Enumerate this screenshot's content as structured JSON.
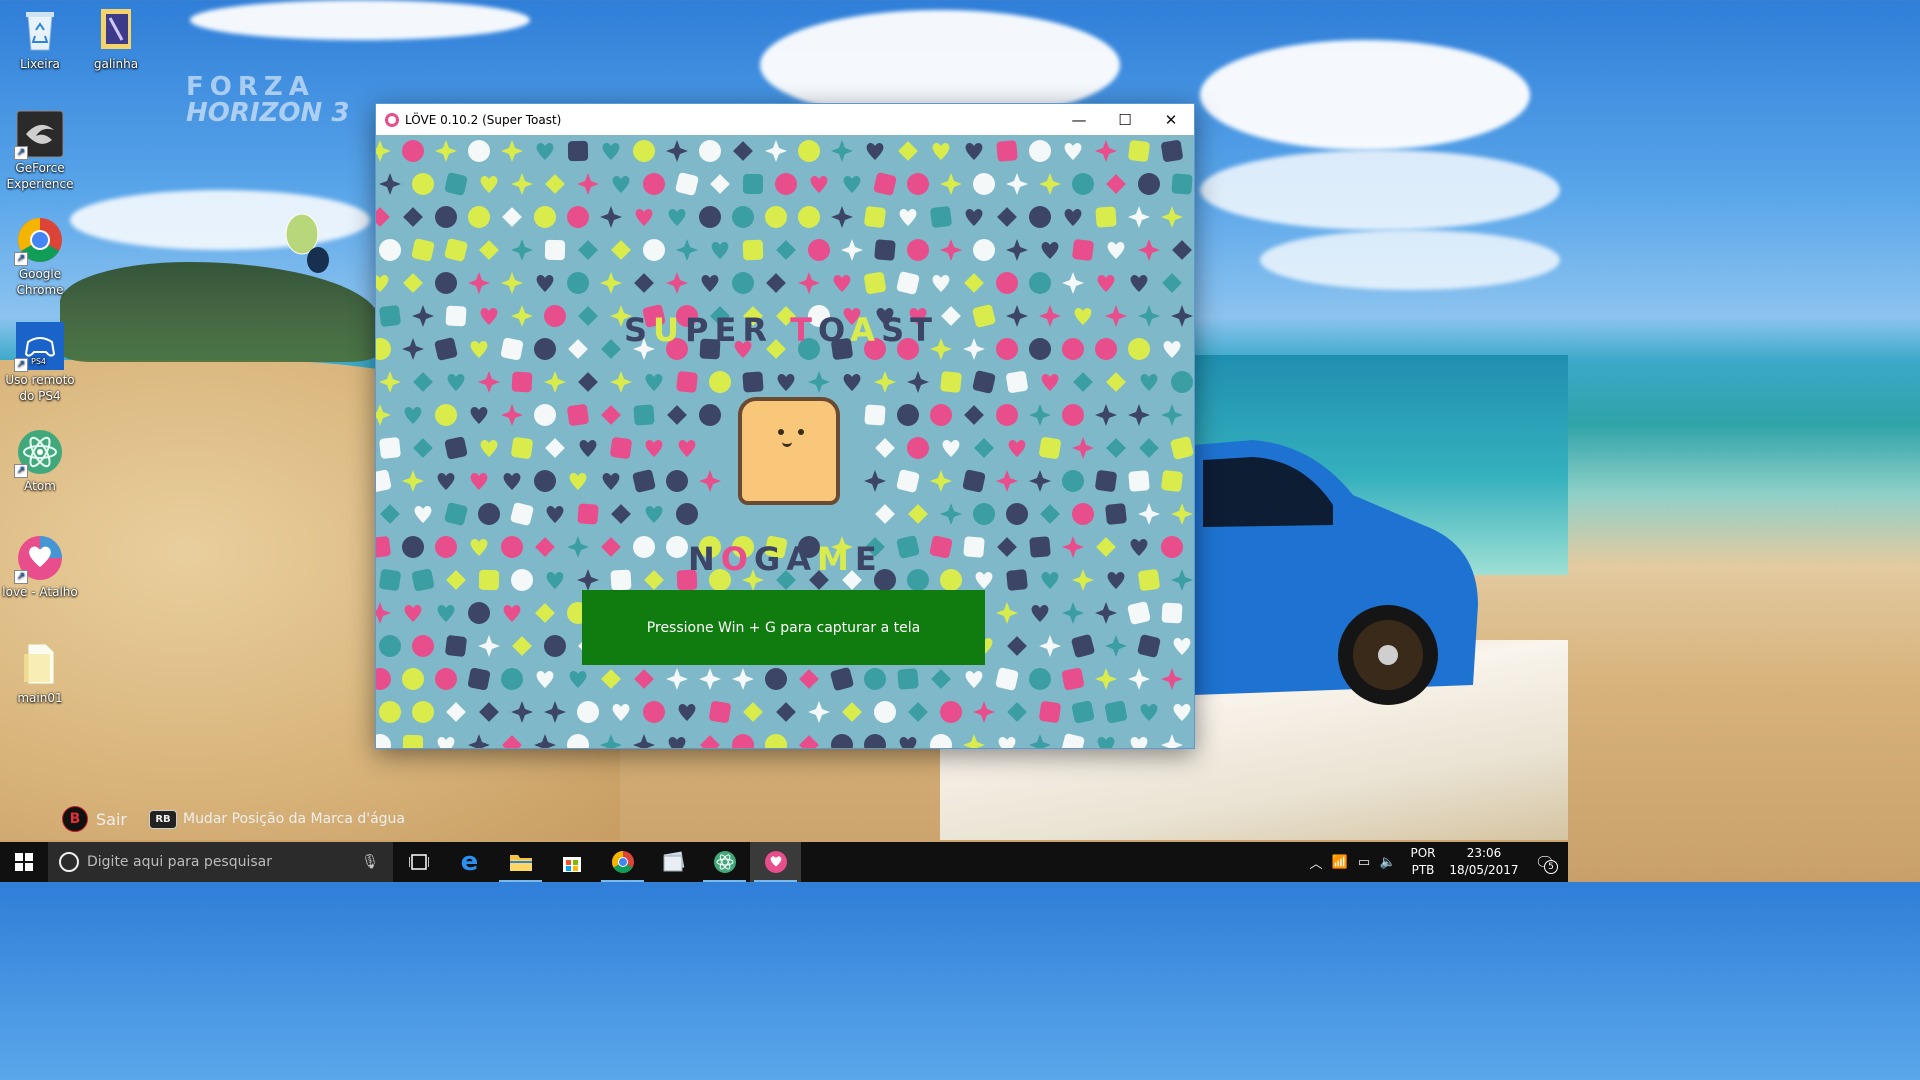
{
  "desktop": {
    "wallpaper_logo": {
      "line1": "FORZA",
      "line2": "HORIZON 3"
    },
    "icons": [
      {
        "label": "Lixeira"
      },
      {
        "label": "galinha"
      },
      {
        "label": "GeForce Experience"
      },
      {
        "label": "Google Chrome"
      },
      {
        "label": "Uso remoto do PS4",
        "badge": "PS4"
      },
      {
        "label": "Atom"
      },
      {
        "label": "love - Atalho"
      },
      {
        "label": "main01"
      }
    ]
  },
  "window": {
    "title": "LÖVE 0.10.2 (Super Toast)",
    "controls": {
      "minimize": "—",
      "maximize": "☐",
      "close": "✕"
    },
    "game": {
      "logo_top": [
        "S",
        "U",
        "P",
        "E",
        "R",
        " ",
        "T",
        "O",
        "A",
        "S",
        "T"
      ],
      "logo_bottom": [
        "N",
        "O",
        "G",
        "A",
        "M",
        "E"
      ],
      "colors": {
        "bg": "#7fb9c9",
        "navy": "#3d4566",
        "pink": "#e94e8c",
        "yellow": "#d9ec4c",
        "teal": "#3a9ea3",
        "white": "#f4f8f9"
      }
    }
  },
  "gamebar_toast": {
    "text": "Pressione Win + G para capturar a tela",
    "color": "#107c10"
  },
  "gamebar_hint": {
    "b_key": "B",
    "b_label": "Sair",
    "rb_key": "RB",
    "rb_label": "Mudar Posição da Marca d'água"
  },
  "taskbar": {
    "search_placeholder": "Digite aqui para pesquisar",
    "apps": [
      "task-view",
      "edge",
      "file-explorer",
      "store",
      "chrome",
      "photos",
      "atom",
      "love"
    ],
    "language": {
      "line1": "POR",
      "line2": "PTB"
    },
    "clock": {
      "time": "23:06",
      "date": "18/05/2017"
    },
    "notifications_count": "5"
  }
}
